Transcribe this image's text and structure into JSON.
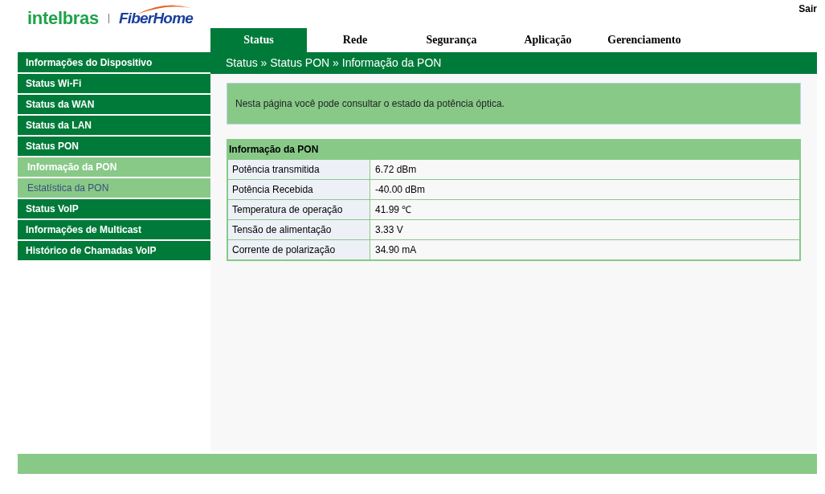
{
  "logo": {
    "brand": "intelbras",
    "partner": "FiberHome"
  },
  "logout": "Sair",
  "tabs": [
    {
      "label": "Status",
      "selected": true
    },
    {
      "label": "Rede",
      "selected": false
    },
    {
      "label": "Segurança",
      "selected": false
    },
    {
      "label": "Aplicação",
      "selected": false
    },
    {
      "label": "Gerenciamento",
      "selected": false
    }
  ],
  "breadcrumb": "Status » Status PON » Informação da PON",
  "sidebar": {
    "items": [
      {
        "label": "Informações do Dispositivo",
        "selected": false
      },
      {
        "label": "Status Wi-Fi",
        "selected": false
      },
      {
        "label": "Status da WAN",
        "selected": false
      },
      {
        "label": "Status da LAN",
        "selected": false
      },
      {
        "label": "Status PON",
        "selected": false,
        "children": [
          {
            "label": "Informação da PON",
            "selected": true
          },
          {
            "label": "Estatística da PON",
            "selected": false
          }
        ]
      },
      {
        "label": "Status VoIP",
        "selected": false
      },
      {
        "label": "Informações de Multicast",
        "selected": false
      },
      {
        "label": "Histórico de Chamadas VoIP",
        "selected": false
      }
    ]
  },
  "notice": "Nesta página você pode consultar o estado da potência óptica.",
  "table": {
    "title": "Informação da PON",
    "rows": [
      {
        "label": "Potência transmitida",
        "value": "6.72 dBm"
      },
      {
        "label": "Potência Recebida",
        "value": "-40.00 dBm"
      },
      {
        "label": "Temperatura de operação",
        "value": "41.99 ℃"
      },
      {
        "label": "Tensão de alimentação",
        "value": "3.33 V"
      },
      {
        "label": "Corrente de polarização",
        "value": "34.90 mA"
      }
    ]
  }
}
